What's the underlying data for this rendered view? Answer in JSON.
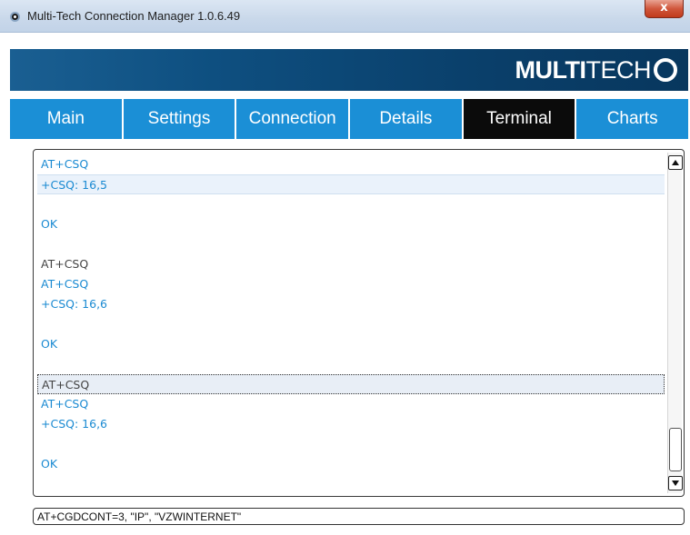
{
  "window": {
    "title": "Multi-Tech Connection Manager 1.0.6.49",
    "close_label": "x"
  },
  "brand": {
    "logo_bold": "MULTI",
    "logo_light": "TECH"
  },
  "tabs": [
    {
      "label": "Main",
      "active": false
    },
    {
      "label": "Settings",
      "active": false
    },
    {
      "label": "Connection",
      "active": false
    },
    {
      "label": "Details",
      "active": false
    },
    {
      "label": "Terminal",
      "active": true
    },
    {
      "label": "Charts",
      "active": false
    }
  ],
  "terminal": {
    "lines": [
      "AT+CSQ",
      "+CSQ: 16,5",
      "",
      "OK",
      "",
      "AT+CSQ",
      "AT+CSQ",
      "+CSQ: 16,6",
      "",
      "OK",
      "",
      "AT+CSQ",
      "AT+CSQ",
      "+CSQ: 16,6",
      "",
      "OK"
    ]
  },
  "command_input": {
    "value": "AT+CGDCONT=3, \"IP\", \"VZWINTERNET\""
  },
  "colors": {
    "tab_blue": "#1b8fd6",
    "tab_active": "#0b0b0b",
    "response_text": "#1a8ad2",
    "brand_dark": "#0a3f6a"
  }
}
